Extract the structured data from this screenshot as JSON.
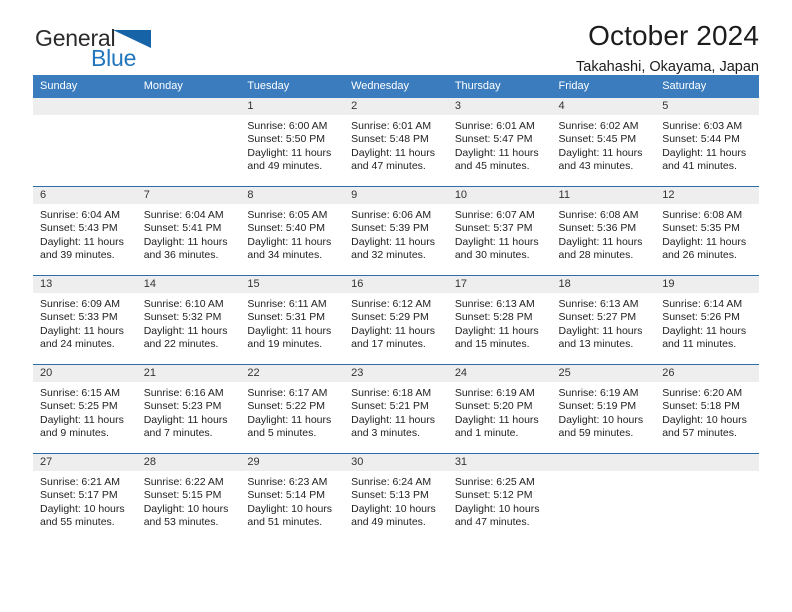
{
  "brand": {
    "name_part1": "General",
    "name_part2": "Blue",
    "triangle_color": "#1663a8",
    "text_color": "#2b2b2b",
    "blue_color": "#2176bd",
    "logo_icon": "triangle-flag-icon"
  },
  "header": {
    "title": "October 2024",
    "subtitle": "Takahashi, Okayama, Japan"
  },
  "theme": {
    "header_bg": "#3a7cbe",
    "header_text": "#ffffff",
    "row_divider": "#2e6da7",
    "daynum_band_bg": "#eeeeee",
    "cell_bg": "#ffffff",
    "body_text": "#222222"
  },
  "weekdays": [
    "Sunday",
    "Monday",
    "Tuesday",
    "Wednesday",
    "Thursday",
    "Friday",
    "Saturday"
  ],
  "weeks": [
    [
      {
        "day": "",
        "info": ""
      },
      {
        "day": "",
        "info": ""
      },
      {
        "day": "1",
        "info": "Sunrise: 6:00 AM\nSunset: 5:50 PM\nDaylight: 11 hours\nand 49 minutes."
      },
      {
        "day": "2",
        "info": "Sunrise: 6:01 AM\nSunset: 5:48 PM\nDaylight: 11 hours\nand 47 minutes."
      },
      {
        "day": "3",
        "info": "Sunrise: 6:01 AM\nSunset: 5:47 PM\nDaylight: 11 hours\nand 45 minutes."
      },
      {
        "day": "4",
        "info": "Sunrise: 6:02 AM\nSunset: 5:45 PM\nDaylight: 11 hours\nand 43 minutes."
      },
      {
        "day": "5",
        "info": "Sunrise: 6:03 AM\nSunset: 5:44 PM\nDaylight: 11 hours\nand 41 minutes."
      }
    ],
    [
      {
        "day": "6",
        "info": "Sunrise: 6:04 AM\nSunset: 5:43 PM\nDaylight: 11 hours\nand 39 minutes."
      },
      {
        "day": "7",
        "info": "Sunrise: 6:04 AM\nSunset: 5:41 PM\nDaylight: 11 hours\nand 36 minutes."
      },
      {
        "day": "8",
        "info": "Sunrise: 6:05 AM\nSunset: 5:40 PM\nDaylight: 11 hours\nand 34 minutes."
      },
      {
        "day": "9",
        "info": "Sunrise: 6:06 AM\nSunset: 5:39 PM\nDaylight: 11 hours\nand 32 minutes."
      },
      {
        "day": "10",
        "info": "Sunrise: 6:07 AM\nSunset: 5:37 PM\nDaylight: 11 hours\nand 30 minutes."
      },
      {
        "day": "11",
        "info": "Sunrise: 6:08 AM\nSunset: 5:36 PM\nDaylight: 11 hours\nand 28 minutes."
      },
      {
        "day": "12",
        "info": "Sunrise: 6:08 AM\nSunset: 5:35 PM\nDaylight: 11 hours\nand 26 minutes."
      }
    ],
    [
      {
        "day": "13",
        "info": "Sunrise: 6:09 AM\nSunset: 5:33 PM\nDaylight: 11 hours\nand 24 minutes."
      },
      {
        "day": "14",
        "info": "Sunrise: 6:10 AM\nSunset: 5:32 PM\nDaylight: 11 hours\nand 22 minutes."
      },
      {
        "day": "15",
        "info": "Sunrise: 6:11 AM\nSunset: 5:31 PM\nDaylight: 11 hours\nand 19 minutes."
      },
      {
        "day": "16",
        "info": "Sunrise: 6:12 AM\nSunset: 5:29 PM\nDaylight: 11 hours\nand 17 minutes."
      },
      {
        "day": "17",
        "info": "Sunrise: 6:13 AM\nSunset: 5:28 PM\nDaylight: 11 hours\nand 15 minutes."
      },
      {
        "day": "18",
        "info": "Sunrise: 6:13 AM\nSunset: 5:27 PM\nDaylight: 11 hours\nand 13 minutes."
      },
      {
        "day": "19",
        "info": "Sunrise: 6:14 AM\nSunset: 5:26 PM\nDaylight: 11 hours\nand 11 minutes."
      }
    ],
    [
      {
        "day": "20",
        "info": "Sunrise: 6:15 AM\nSunset: 5:25 PM\nDaylight: 11 hours\nand 9 minutes."
      },
      {
        "day": "21",
        "info": "Sunrise: 6:16 AM\nSunset: 5:23 PM\nDaylight: 11 hours\nand 7 minutes."
      },
      {
        "day": "22",
        "info": "Sunrise: 6:17 AM\nSunset: 5:22 PM\nDaylight: 11 hours\nand 5 minutes."
      },
      {
        "day": "23",
        "info": "Sunrise: 6:18 AM\nSunset: 5:21 PM\nDaylight: 11 hours\nand 3 minutes."
      },
      {
        "day": "24",
        "info": "Sunrise: 6:19 AM\nSunset: 5:20 PM\nDaylight: 11 hours\nand 1 minute."
      },
      {
        "day": "25",
        "info": "Sunrise: 6:19 AM\nSunset: 5:19 PM\nDaylight: 10 hours\nand 59 minutes."
      },
      {
        "day": "26",
        "info": "Sunrise: 6:20 AM\nSunset: 5:18 PM\nDaylight: 10 hours\nand 57 minutes."
      }
    ],
    [
      {
        "day": "27",
        "info": "Sunrise: 6:21 AM\nSunset: 5:17 PM\nDaylight: 10 hours\nand 55 minutes."
      },
      {
        "day": "28",
        "info": "Sunrise: 6:22 AM\nSunset: 5:15 PM\nDaylight: 10 hours\nand 53 minutes."
      },
      {
        "day": "29",
        "info": "Sunrise: 6:23 AM\nSunset: 5:14 PM\nDaylight: 10 hours\nand 51 minutes."
      },
      {
        "day": "30",
        "info": "Sunrise: 6:24 AM\nSunset: 5:13 PM\nDaylight: 10 hours\nand 49 minutes."
      },
      {
        "day": "31",
        "info": "Sunrise: 6:25 AM\nSunset: 5:12 PM\nDaylight: 10 hours\nand 47 minutes."
      },
      {
        "day": "",
        "info": ""
      },
      {
        "day": "",
        "info": ""
      }
    ]
  ]
}
